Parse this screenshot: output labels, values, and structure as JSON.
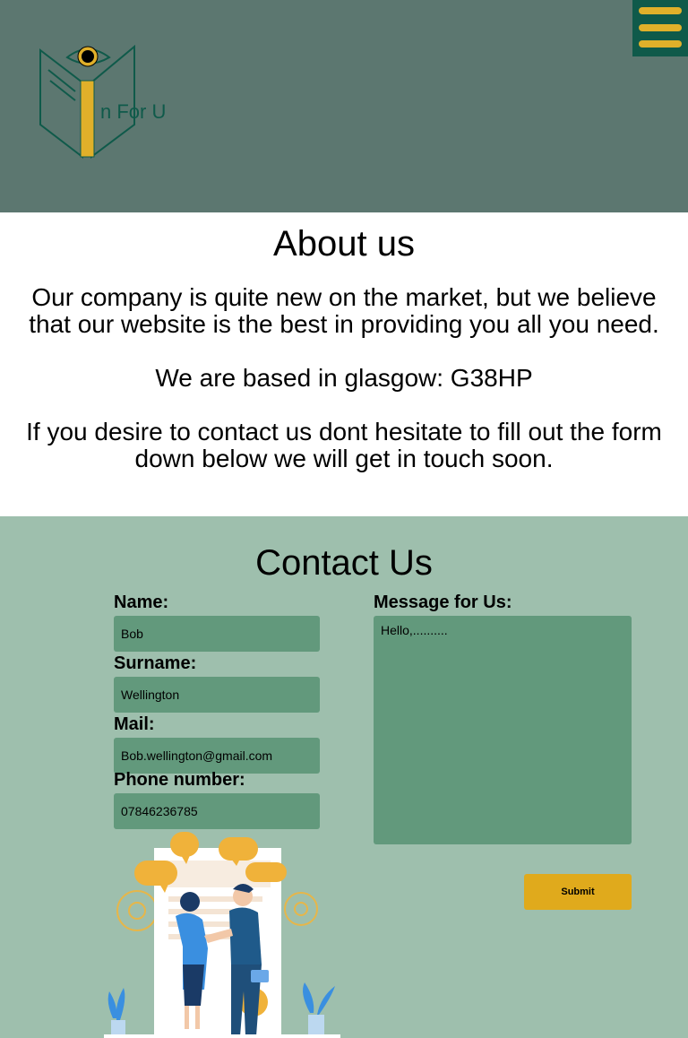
{
  "header": {
    "logo_text": "n For U",
    "colors": {
      "background": "#5c7770",
      "menu_button": "#0f5a4a",
      "accent": "#e0b02a"
    },
    "menu_icon": "hamburger-icon"
  },
  "about": {
    "title": "About us",
    "paragraph_1": "Our company is quite new on the market, but we believe that our website is the best in providing you all you need.",
    "paragraph_2": "We are based in glasgow: G38HP",
    "paragraph_3": "If you desire to contact us dont hesitate to fill out the form down below we will get in touch soon."
  },
  "contact": {
    "title": "Contact Us",
    "background": "#9ebfad",
    "fields": {
      "name": {
        "label": "Name:",
        "value": "Bob"
      },
      "surname": {
        "label": "Surname:",
        "value": "Wellington"
      },
      "mail": {
        "label": "Mail:",
        "value": "Bob.wellington@gmail.com"
      },
      "phone": {
        "label": "Phone number:",
        "value": "07846236785"
      },
      "message": {
        "label": "Message for Us:",
        "value": "Hello,.........."
      }
    },
    "submit_label": "Submit",
    "illustration": "handshake-people-illustration"
  }
}
